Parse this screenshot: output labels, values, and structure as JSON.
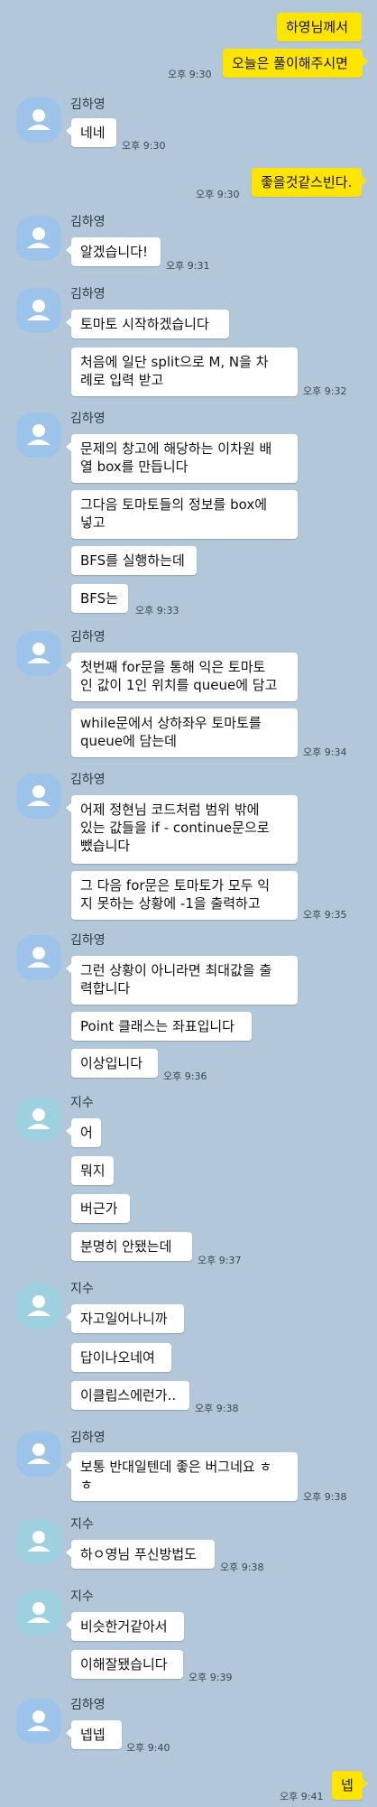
{
  "messages": {
    "m1": "하영님께서",
    "m2": "오늘은 풀이해주시면",
    "m3": "네네",
    "m4": "좋을것같스빈다.",
    "m5": "알겠습니다!",
    "m6": "토마토 시작하겠습니다",
    "m7a": "처음에 일단 split으로 M, N을 차",
    "m7b": "례로 입력 받고",
    "m8a": "문제의 창고에 해당하는 이차원 배",
    "m8b": "열 box를 만듭니다",
    "m9a": "그다음 토마토들의 정보를 box에",
    "m9b": "넣고",
    "m10": "BFS를 실행하는데",
    "m11": "BFS는",
    "m12a": "첫번째 for문을 통해 익은 토마토",
    "m12b": "인 값이 1인 위치를 queue에 담고",
    "m13a": "while문에서 상하좌우 토마토를",
    "m13b": "queue에 담는데",
    "m14a": "어제 정현님 코드처럼 범위 밖에",
    "m14b": "있는 값들을 if - continue문으로",
    "m14c": "뺐습니다",
    "m15a": "그 다음 for문은 토마토가 모두 익",
    "m15b": "지 못하는 상황에 -1을 출력하고",
    "m16a": "그런 상황이 아니라면 최대값을 출",
    "m16b": "력합니다",
    "m17": "Point 클래스는 좌표입니다",
    "m18": "이상입니다",
    "m19": "어",
    "m20": "뭐지",
    "m21": "버근가",
    "m22": "분명히 안됐는데",
    "m23": "자고일어나니까",
    "m24": "답이나오네여",
    "m25": "이클립스에런가..",
    "m26a": "보통 반대일텐데 좋은 버그네요 ㅎ",
    "m26b": "ㅎ",
    "m27": "하ㅇ영님 푸신방법도",
    "m28": "비슷한거같아서",
    "m29": "이해잘됐습니다",
    "m30": "넵넵",
    "m31": "넵"
  },
  "names": {
    "kim": "김하영",
    "jisu": "지수"
  },
  "times": {
    "t930": "오후 9:30",
    "t931": "오후 9:31",
    "t932": "오후 9:32",
    "t933": "오후 9:33",
    "t934": "오후 9:34",
    "t935": "오후 9:35",
    "t936": "오후 9:36",
    "t937": "오후 9:37",
    "t938": "오후 9:38",
    "t939": "오후 9:39",
    "t940": "오후 9:40",
    "t941": "오후 9:41"
  },
  "colors": {
    "background": "#b2c7d9",
    "outgoing_bubble": "#fee500",
    "incoming_bubble": "#ffffff",
    "avatar_blue": "#9cc3e9",
    "avatar_teal": "#9ed1df"
  },
  "icons": {
    "avatar": "default-person-avatar-icon"
  }
}
